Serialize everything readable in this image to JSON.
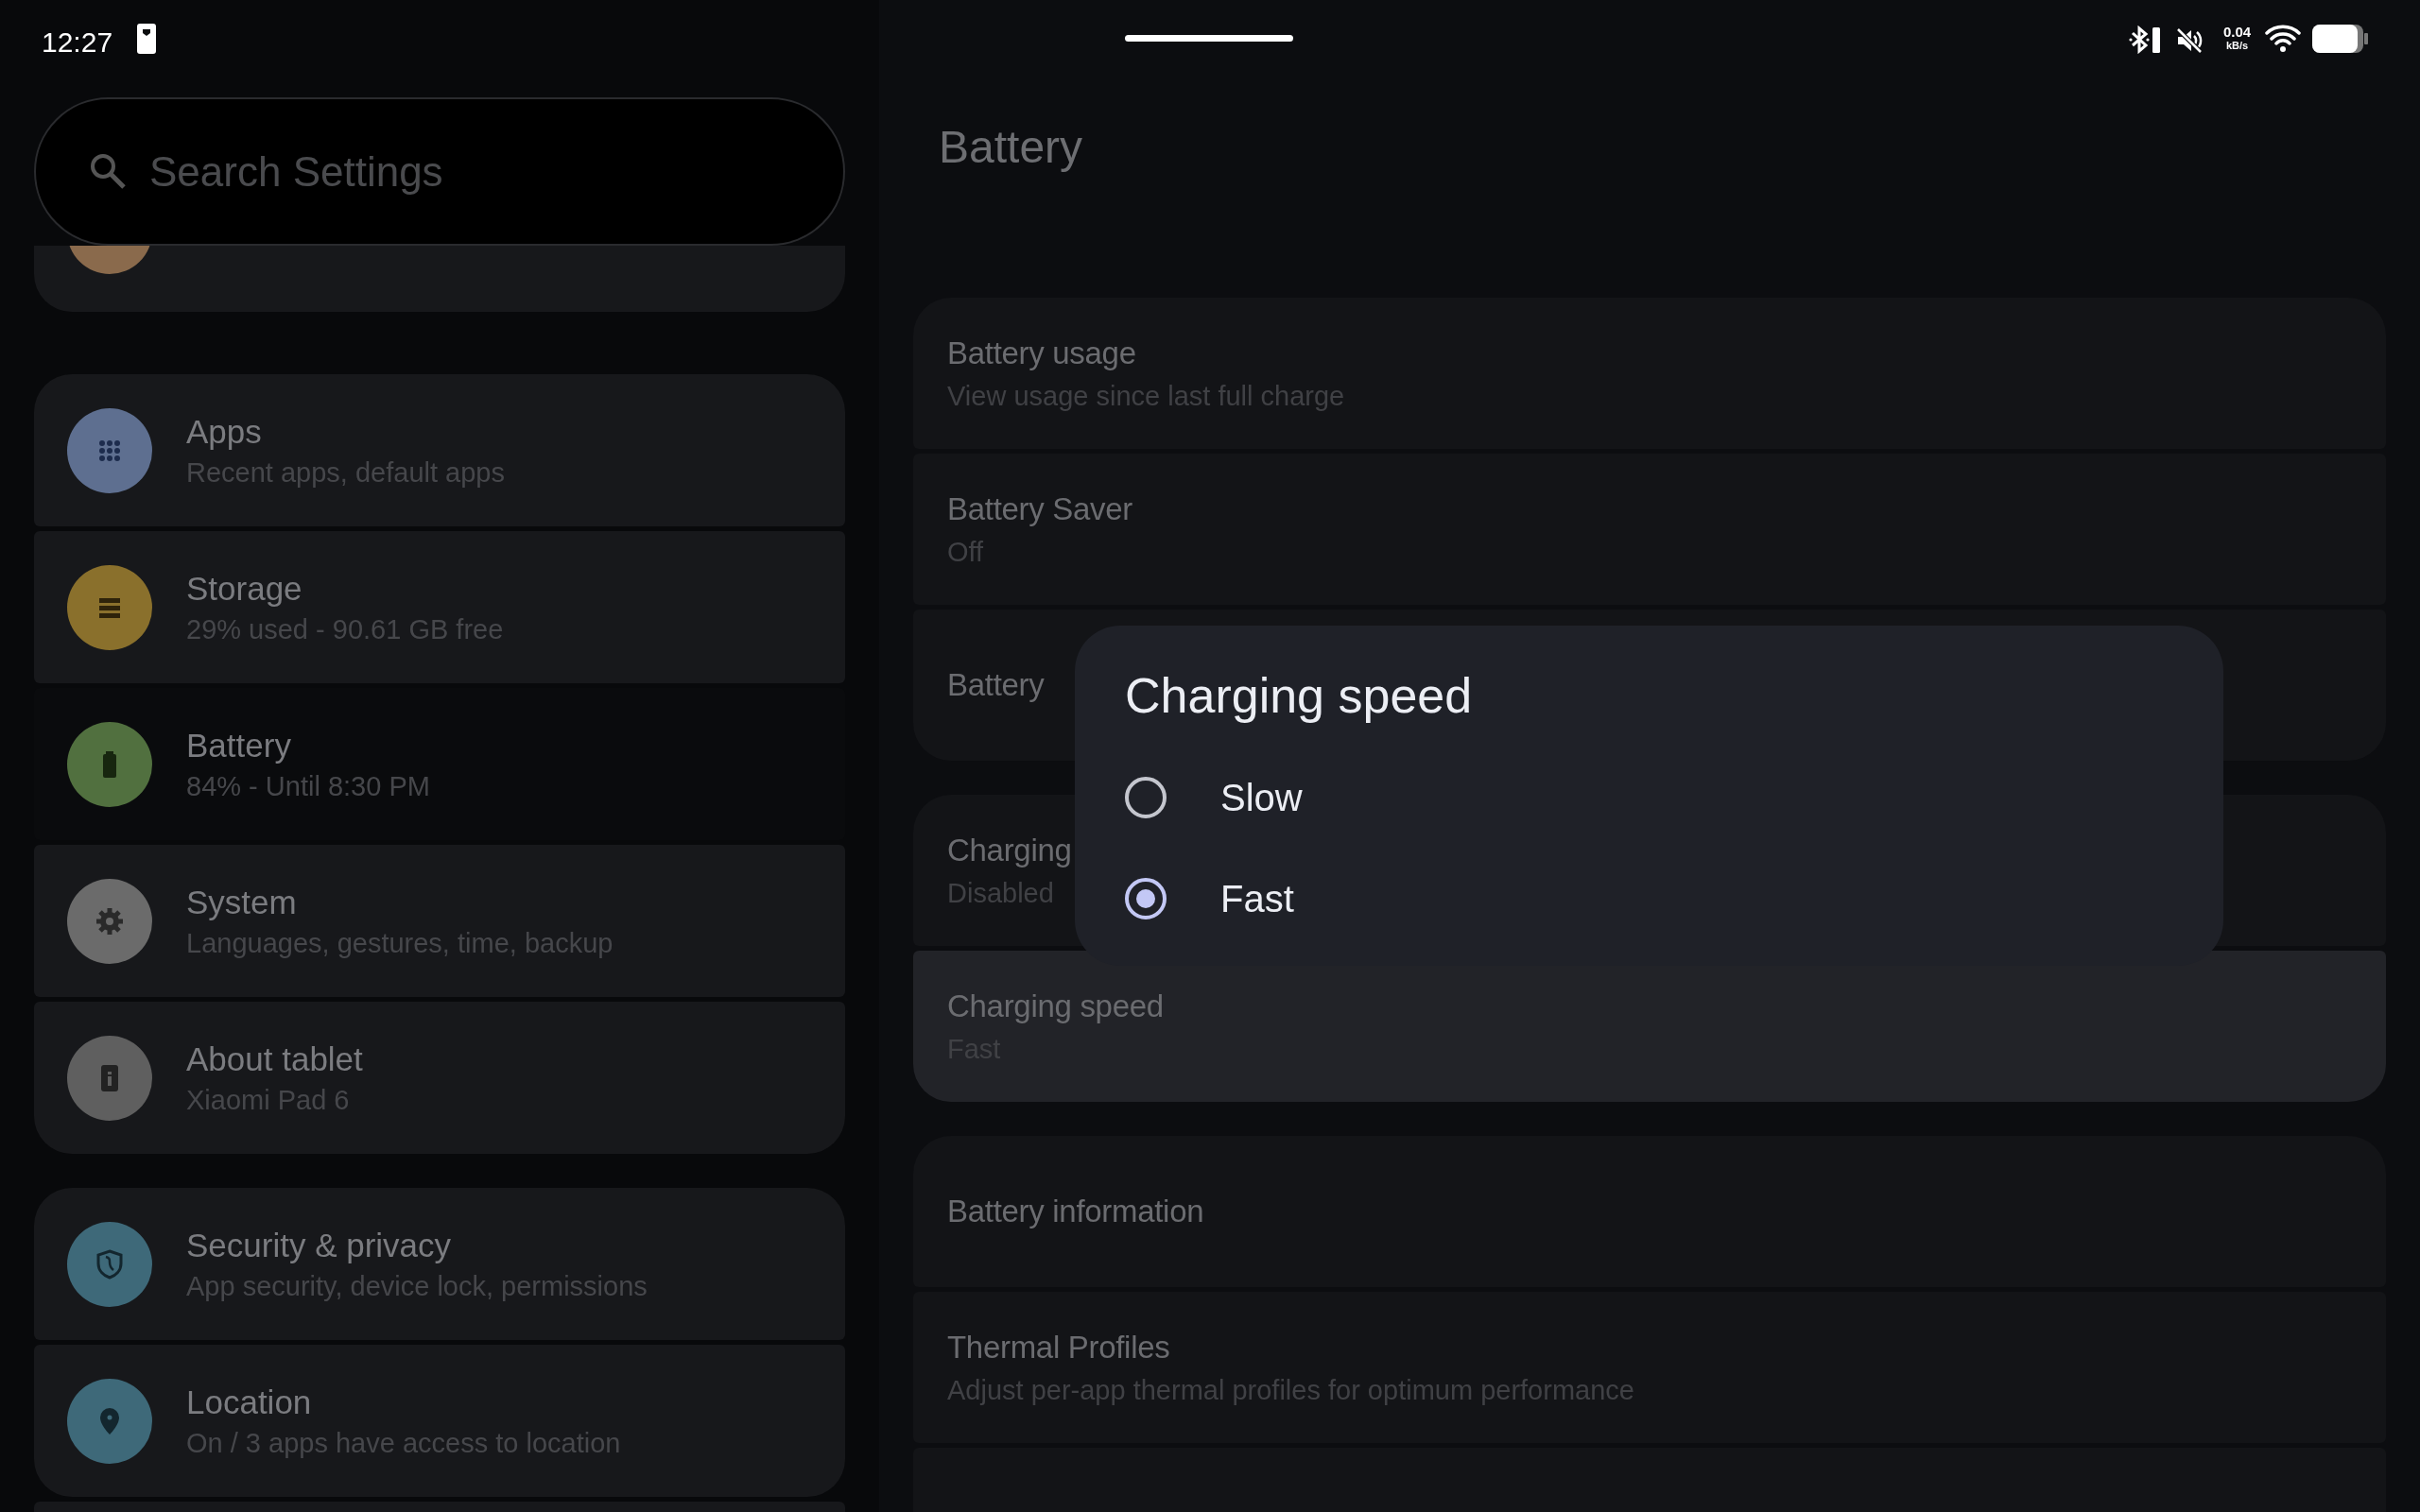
{
  "status_bar": {
    "time": "12:27",
    "net_speed": "0.04",
    "net_unit": "kB/s"
  },
  "search": {
    "placeholder": "Search Settings"
  },
  "sidebar": {
    "groups": [
      {
        "items": [
          {
            "kind": "partial",
            "color": "#8a6a4c"
          }
        ]
      },
      {
        "items": [
          {
            "kind": "apps",
            "title": "Apps",
            "subtitle": "Recent apps, default apps",
            "color": "#5e6f90",
            "selected": false
          },
          {
            "kind": "storage",
            "title": "Storage",
            "subtitle": "29% used - 90.61 GB free",
            "color": "#8a702c",
            "selected": false
          },
          {
            "kind": "battery",
            "title": "Battery",
            "subtitle": "84% - Until 8:30 PM",
            "color": "#51703f",
            "selected": true
          },
          {
            "kind": "system",
            "title": "System",
            "subtitle": "Languages, gestures, time, backup",
            "color": "#6b6b6b",
            "selected": false
          },
          {
            "kind": "about",
            "title": "About tablet",
            "subtitle": "Xiaomi Pad 6",
            "color": "#5f5f5f",
            "selected": false
          }
        ]
      },
      {
        "items": [
          {
            "kind": "security",
            "title": "Security & privacy",
            "subtitle": "App security, device lock, permissions",
            "color": "#3e6979",
            "selected": false
          },
          {
            "kind": "location",
            "title": "Location",
            "subtitle": "On / 3 apps have access to location",
            "color": "#3e6979",
            "selected": false
          }
        ]
      }
    ]
  },
  "page": {
    "title": "Battery",
    "groups": [
      {
        "rows": [
          {
            "title": "Battery usage",
            "subtitle": "View usage since last full charge",
            "highlighted": false
          },
          {
            "title": "Battery Saver",
            "subtitle": "Off",
            "highlighted": false
          },
          {
            "title": "Battery",
            "highlighted": false
          }
        ]
      },
      {
        "rows": [
          {
            "title": "Charging",
            "subtitle": "Disabled",
            "highlighted": false
          },
          {
            "title": "Charging speed",
            "subtitle": "Fast",
            "highlighted": true
          }
        ]
      },
      {
        "rows": [
          {
            "title": "Battery information",
            "highlighted": false
          },
          {
            "title": "Thermal Profiles",
            "subtitle": "Adjust per-app thermal profiles for optimum performance",
            "highlighted": false
          },
          {
            "highlighted": false
          }
        ]
      }
    ]
  },
  "dialog": {
    "title": "Charging speed",
    "options": [
      {
        "label": "Slow",
        "selected": false
      },
      {
        "label": "Fast",
        "selected": true
      }
    ]
  }
}
